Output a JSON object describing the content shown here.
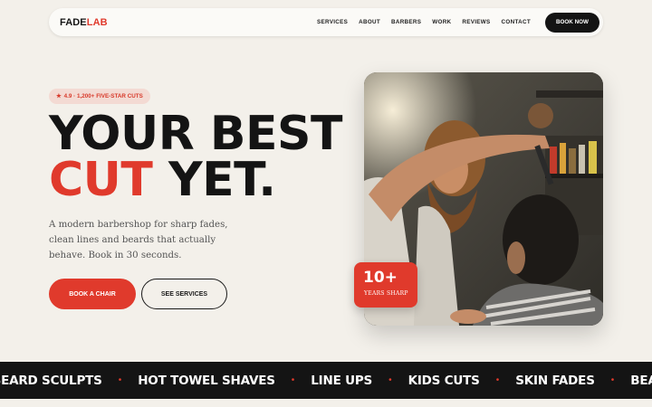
{
  "nav": {
    "logo_part1": "FADE",
    "logo_part2": "LAB",
    "links": [
      "SERVICES",
      "ABOUT",
      "BARBERS",
      "WORK",
      "REVIEWS",
      "CONTACT"
    ],
    "cta": "BOOK NOW"
  },
  "hero": {
    "badge_icon": "★",
    "badge": "4.9 · 1,200+ FIVE-STAR CUTS",
    "headline_line1": "YOUR BEST",
    "headline_red": "CUT",
    "headline_rest": " YET.",
    "subtext": "A modern barbershop for sharp fades, clean lines and beards that actually behave. Book in 30 seconds.",
    "primary_button": "BOOK A CHAIR",
    "secondary_button": "SEE SERVICES"
  },
  "stat": {
    "number": "10+",
    "label": "YEARS SHARP"
  },
  "marquee": {
    "items": [
      "BEARD SCULPTS",
      "HOT TOWEL SHAVES",
      "LINE UPS",
      "KIDS CUTS",
      "SKIN FADES",
      "BEARD SCULPTS"
    ],
    "separator": "•"
  },
  "colors": {
    "accent": "#e03a2c",
    "dark": "#141414",
    "background": "#f3f0ea"
  }
}
